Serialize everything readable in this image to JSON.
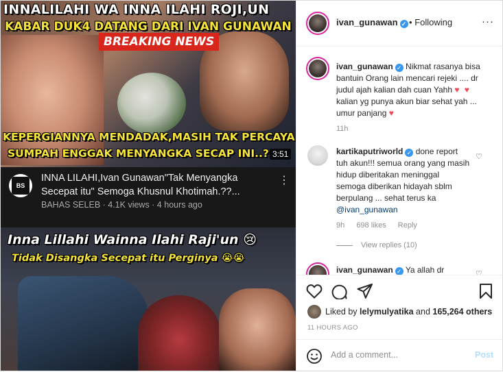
{
  "media": {
    "top_thumb": {
      "line1": "INNALILAHI WA INNA ILAHI ROJI,UN",
      "line2": "KABAR DUK4 DATANG DARI IVAN GUNAWAN",
      "badge": "BREAKING NEWS",
      "line3": "KEPERGIANNYA MENDADAK,MASIH TAK PERCAYA",
      "line4": "SUMPAH ENGGAK MENYANGKA SECAP INI..?",
      "duration": "3:51"
    },
    "yt_info": {
      "channel_logo_text": "BS",
      "title": "INNA LILAHI,Ivan Gunawan\"Tak Menyangka Secepat itu\" Semoga Khusnul Khotimah.??...",
      "meta": "BAHAS SELEB · 4.1K views · 4 hours ago"
    },
    "bottom_thumb": {
      "line1": "Inna Lillahi Wainna Ilahi Raji'un 😢",
      "line2": "Tidak Disangka Secepat itu Perginya 😭😭"
    }
  },
  "header": {
    "username": "ivan_gunawan",
    "separator": "•",
    "follow_status": "Following",
    "more": "···"
  },
  "caption": {
    "username": "ivan_gunawan",
    "text": "Nikmat rasanya bisa bantuin Orang lain mencari rejeki .... dr judul ajah kalian dah cuan Yahh",
    "text2": "kalian yg punya akun biar sehat yah ... umur panjang",
    "time": "11h"
  },
  "comments": [
    {
      "username": "kartikaputriworld",
      "text": "done report tuh akun!!! semua orang yang masih hidup diberitakan meninggal semoga diberikan hidayah sblm berpulang ... sehat terus ka",
      "mention": "@ivan_gunawan",
      "time": "9h",
      "likes": "698 likes",
      "reply": "Reply",
      "view_replies": "View replies (10)"
    },
    {
      "username": "ivan_gunawan",
      "text": "Ya allah dr"
    }
  ],
  "actions": {
    "liked_by_prefix": "Liked by",
    "liked_by_user": "lelymulyatika",
    "liked_by_and": "and",
    "liked_by_count": "165,264 others",
    "time_ago": "11 HOURS AGO"
  },
  "add_comment": {
    "placeholder": "Add a comment...",
    "post_label": "Post"
  },
  "colors": {
    "accent": "#3897f0",
    "heart": "#ed4956",
    "muted": "#8e8e8e",
    "post_disabled": "#b2dffc"
  }
}
